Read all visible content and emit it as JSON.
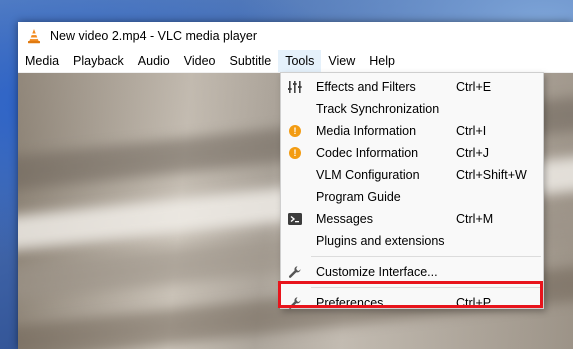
{
  "window": {
    "title": "New video 2.mp4 - VLC media player"
  },
  "menubar": {
    "items": [
      "Media",
      "Playback",
      "Audio",
      "Video",
      "Subtitle",
      "Tools",
      "View",
      "Help"
    ],
    "active": "Tools"
  },
  "tools_menu": {
    "items": [
      {
        "label": "Effects and Filters",
        "shortcut": "Ctrl+E",
        "icon": "equalizer-icon"
      },
      {
        "label": "Track Synchronization",
        "shortcut": "",
        "icon": ""
      },
      {
        "label": "Media Information",
        "shortcut": "Ctrl+I",
        "icon": "info-icon"
      },
      {
        "label": "Codec Information",
        "shortcut": "Ctrl+J",
        "icon": "info-icon"
      },
      {
        "label": "VLM Configuration",
        "shortcut": "Ctrl+Shift+W",
        "icon": ""
      },
      {
        "label": "Program Guide",
        "shortcut": "",
        "icon": ""
      },
      {
        "label": "Messages",
        "shortcut": "Ctrl+M",
        "icon": "terminal-icon"
      },
      {
        "label": "Plugins and extensions",
        "shortcut": "",
        "icon": ""
      },
      {
        "label": "Customize Interface...",
        "shortcut": "",
        "icon": "wrench-icon"
      },
      {
        "label": "Preferences",
        "shortcut": "Ctrl+P",
        "icon": "wrench-icon"
      }
    ]
  },
  "colors": {
    "highlight": "#e8141c",
    "info_icon": "#f39c12",
    "menu_active": "#e5f1fb"
  }
}
